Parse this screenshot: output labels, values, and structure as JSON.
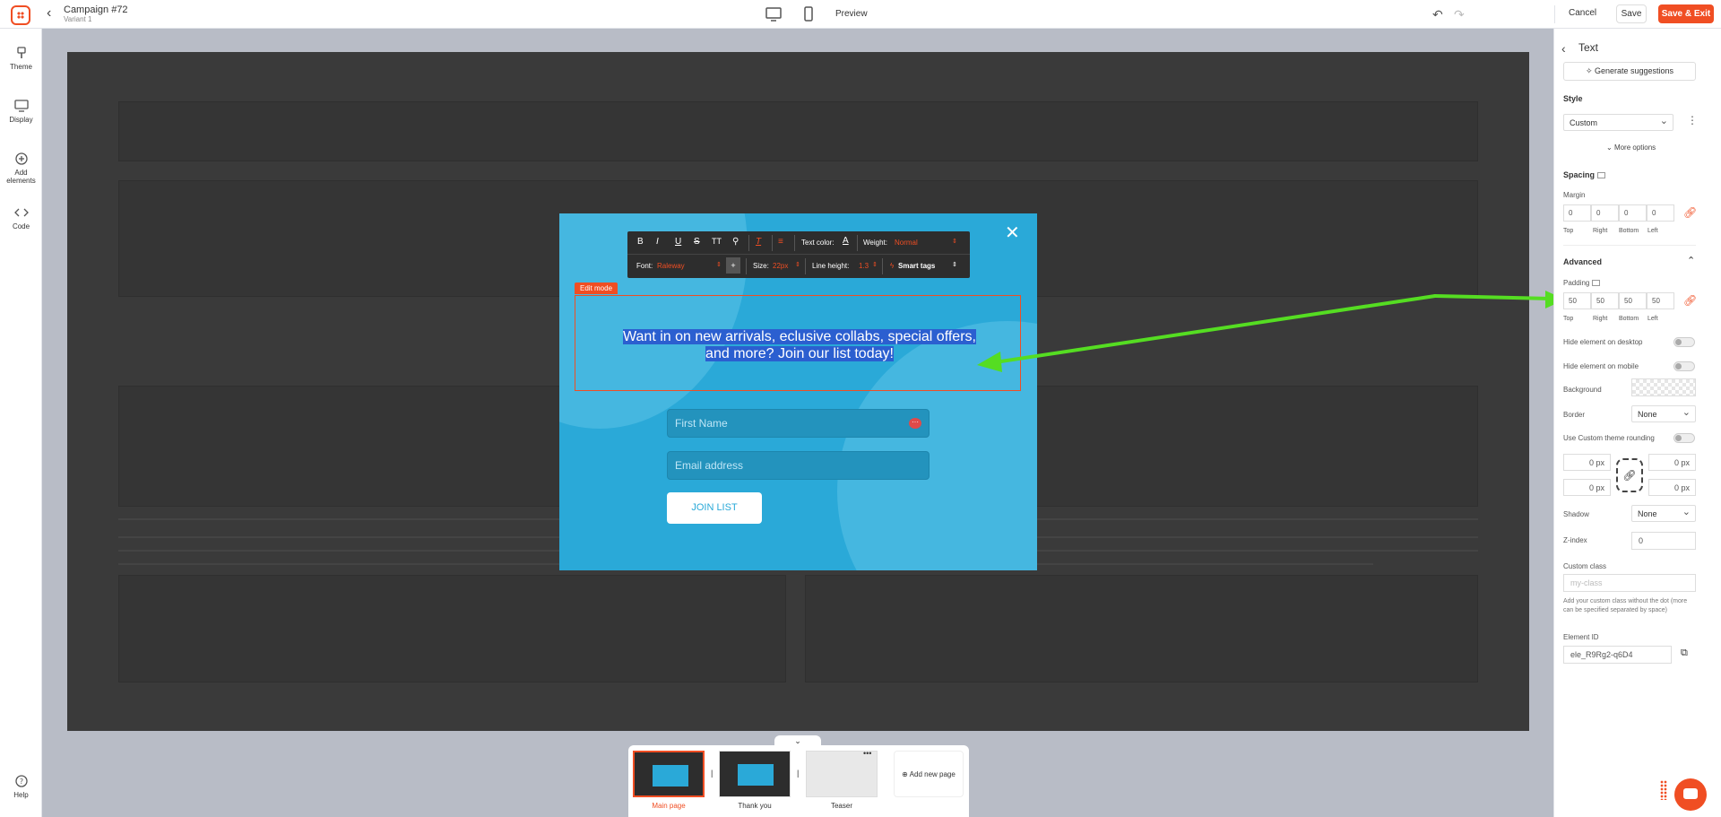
{
  "topbar": {
    "campaign_title": "Campaign #72",
    "variant": "Variant 1",
    "preview_label": "Preview",
    "cancel_label": "Cancel",
    "save_label": "Save",
    "save_exit_label": "Save & Exit"
  },
  "leftbar": {
    "items": [
      {
        "label": "Theme",
        "icon": "brush-icon"
      },
      {
        "label": "Display",
        "icon": "monitor-icon"
      },
      {
        "label": "Add elements",
        "icon": "plus-circle-icon"
      },
      {
        "label": "Code",
        "icon": "code-icon"
      }
    ],
    "help_label": "Help"
  },
  "toolbar": {
    "text_color_label": "Text color:",
    "weight_label": "Weight:",
    "weight_value": "Normal",
    "font_label": "Font:",
    "font_value": "Raleway",
    "size_label": "Size:",
    "size_value": "22px",
    "line_height_label": "Line height:",
    "line_height_value": "1.3",
    "smart_tags_label": "Smart tags"
  },
  "popup": {
    "edit_badge": "Edit mode",
    "headline": "Want in on new arrivals, eclusive collabs, special offers, and more? Join our list today!",
    "first_name_placeholder": "First Name",
    "email_placeholder": "Email address",
    "join_button": "JOIN LIST"
  },
  "pages": {
    "items": [
      {
        "label": "Main page",
        "active": true
      },
      {
        "label": "Thank you",
        "active": false
      },
      {
        "label": "Teaser",
        "active": false
      }
    ],
    "add_label": "Add new page"
  },
  "panel": {
    "title": "Text",
    "generate_label": "Generate suggestions",
    "style_label": "Style",
    "style_value": "Custom",
    "more_options": "More options",
    "spacing_label": "Spacing",
    "margin_label": "Margin",
    "margin_values": [
      "0",
      "0",
      "0",
      "0"
    ],
    "side_labels": [
      "Top",
      "Right",
      "Bottom",
      "Left"
    ],
    "advanced_label": "Advanced",
    "padding_label": "Padding",
    "padding_values": [
      "50",
      "50",
      "50",
      "50"
    ],
    "hide_desktop": "Hide element on desktop",
    "hide_mobile": "Hide element on mobile",
    "background_label": "Background",
    "border_label": "Border",
    "border_value": "None",
    "custom_rounding": "Use Custom theme rounding",
    "radius_values": [
      "0 px",
      "0 px",
      "0 px",
      "0 px"
    ],
    "shadow_label": "Shadow",
    "shadow_value": "None",
    "zindex_label": "Z-index",
    "zindex_value": "0",
    "custom_class_label": "Custom class",
    "custom_class_placeholder": "my-class",
    "custom_class_help": "Add your custom class without the dot (more can be specified separated by space)",
    "element_id_label": "Element ID",
    "element_id_value": "ele_R9Rg2-q6D4"
  },
  "colors": {
    "accent": "#f04e23",
    "popup_bg": "#2aa9d8",
    "selection": "#2b5fd0",
    "annotation_arrow": "#55dd22"
  }
}
